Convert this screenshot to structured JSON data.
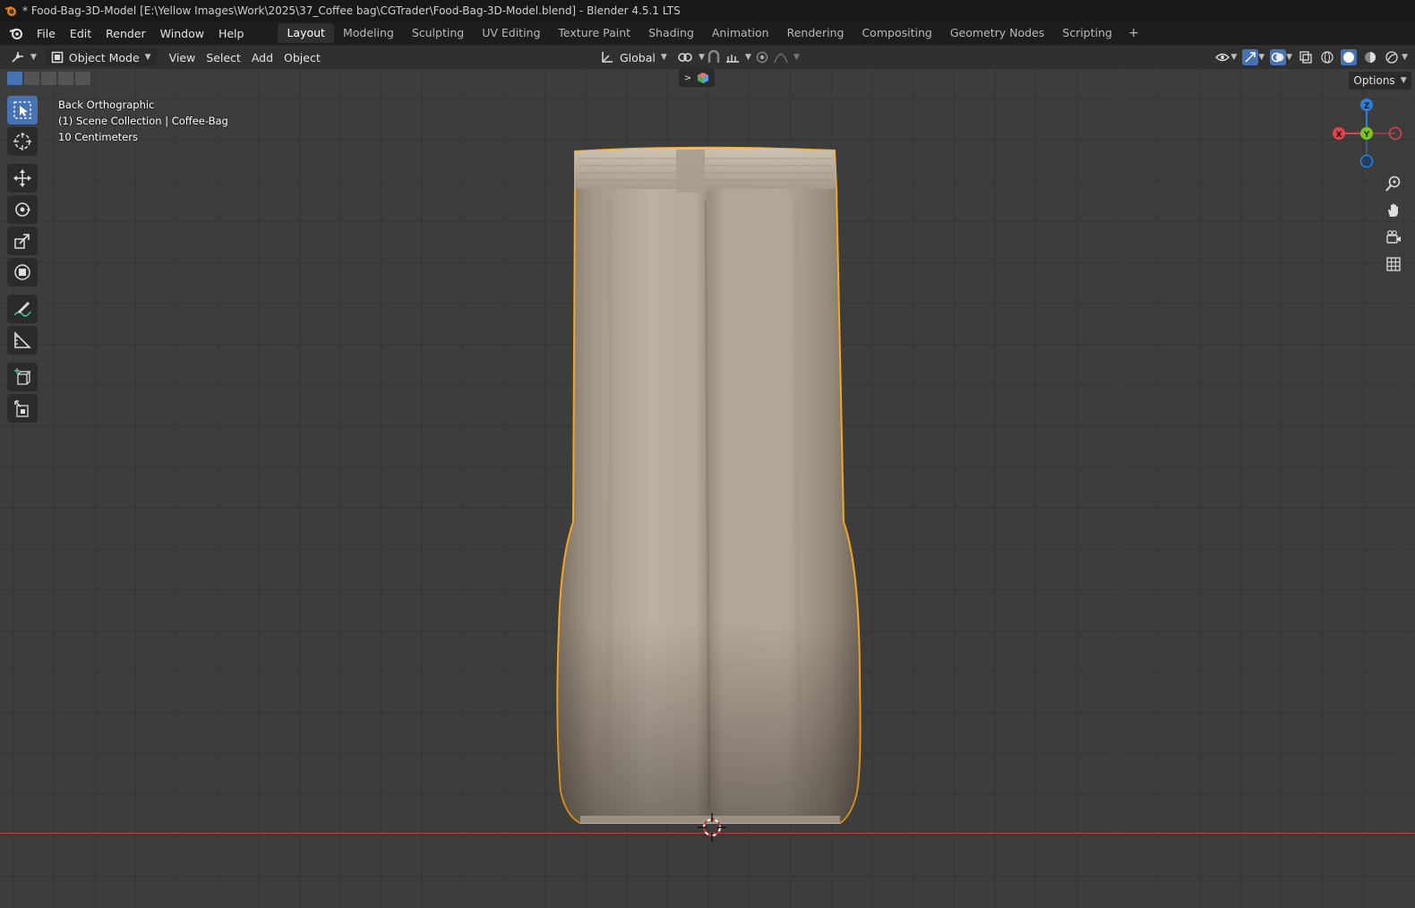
{
  "window": {
    "title": "* Food-Bag-3D-Model [E:\\Yellow Images\\Work\\2025\\37_Coffee bag\\CGTrader\\Food-Bag-3D-Model.blend] - Blender 4.5.1 LTS"
  },
  "menubar": {
    "items": [
      "File",
      "Edit",
      "Render",
      "Window",
      "Help"
    ]
  },
  "workspaces": {
    "tabs": [
      "Layout",
      "Modeling",
      "Sculpting",
      "UV Editing",
      "Texture Paint",
      "Shading",
      "Animation",
      "Rendering",
      "Compositing",
      "Geometry Nodes",
      "Scripting"
    ],
    "active": "Layout",
    "add": "+"
  },
  "header": {
    "mode": "Object Mode",
    "menus": [
      "View",
      "Select",
      "Add",
      "Object"
    ],
    "orientation": "Global"
  },
  "viewport": {
    "info_lines": [
      "Back Orthographic",
      "(1) Scene Collection | Coffee-Bag",
      "10 Centimeters"
    ],
    "options_label": "Options",
    "gizmo": {
      "z": "Z",
      "y": "Y",
      "x": "X"
    }
  },
  "tools": [
    "select-box",
    "cursor",
    "move",
    "rotate",
    "scale",
    "transform",
    "annotate",
    "measure",
    "add-cube",
    "extrude"
  ],
  "colors": {
    "accent": "#4772b3",
    "selection": "#f5a623",
    "bag": "#b8aa99",
    "x_axis": "#e0424c",
    "y_axis": "#7cc41f",
    "z_axis": "#2f7fd8"
  }
}
